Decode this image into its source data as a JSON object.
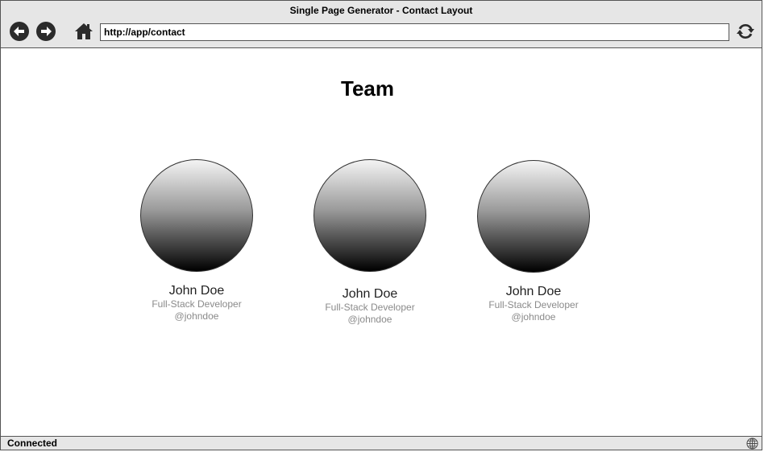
{
  "window": {
    "title": "Single Page Generator - Contact Layout"
  },
  "toolbar": {
    "url": "http://app/contact"
  },
  "page": {
    "title": "Team"
  },
  "members": [
    {
      "name": "John Doe",
      "role": "Full-Stack Developer",
      "handle": "@johndoe"
    },
    {
      "name": "John Doe",
      "role": "Full-Stack Developer",
      "handle": "@johndoe"
    },
    {
      "name": "John Doe",
      "role": "Full-Stack Developer",
      "handle": "@johndoe"
    }
  ],
  "status": {
    "text": "Connected"
  },
  "icons": {
    "back": "arrow-left-icon",
    "forward": "arrow-right-icon",
    "home": "home-icon",
    "reload": "reload-icon",
    "network": "globe-icon"
  }
}
